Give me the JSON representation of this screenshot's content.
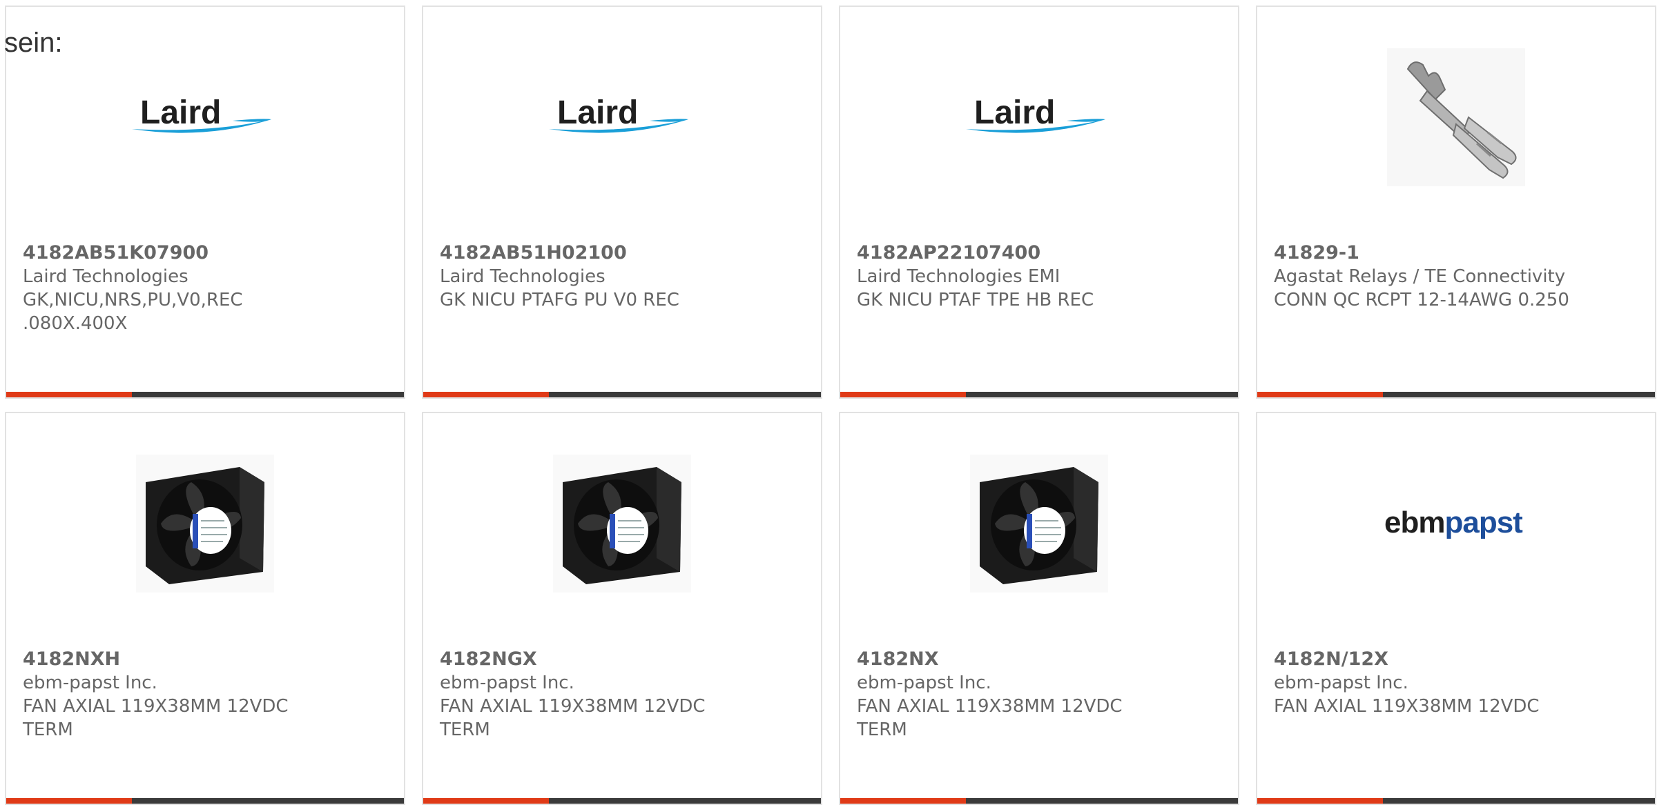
{
  "intro_text": "sein:",
  "colors": {
    "accent_bar": "#e03a17",
    "bar_dark": "#3a3a3a",
    "card_text": "#666666",
    "laird_blue": "#1a9fd8",
    "ebmpapst_blue": "#1d4e9b"
  },
  "products": [
    {
      "part_number": "4182AB51K07900",
      "manufacturer": "Laird Technologies",
      "desc_line1": "GK,NICU,NRS,PU,V0,REC",
      "desc_line2": ".080X.400X",
      "image": "laird-logo",
      "logo_text": "Laird"
    },
    {
      "part_number": "4182AB51H02100",
      "manufacturer": "Laird Technologies",
      "desc_line1": "GK NICU PTAFG PU V0 REC",
      "desc_line2": "",
      "image": "laird-logo",
      "logo_text": "Laird"
    },
    {
      "part_number": "4182AP22107400",
      "manufacturer": "Laird Technologies EMI",
      "desc_line1": "GK NICU PTAF TPE HB REC",
      "desc_line2": "",
      "image": "laird-logo",
      "logo_text": "Laird"
    },
    {
      "part_number": "41829-1",
      "manufacturer": "Agastat Relays / TE Connectivity",
      "desc_line1": "CONN QC RCPT 12-14AWG 0.250",
      "desc_line2": "",
      "image": "connector-image"
    },
    {
      "part_number": "4182NXH",
      "manufacturer": "ebm-papst Inc.",
      "desc_line1": "FAN AXIAL 119X38MM 12VDC",
      "desc_line2": "TERM",
      "image": "fan-image"
    },
    {
      "part_number": "4182NGX",
      "manufacturer": "ebm-papst Inc.",
      "desc_line1": "FAN AXIAL 119X38MM 12VDC",
      "desc_line2": "TERM",
      "image": "fan-image"
    },
    {
      "part_number": "4182NX",
      "manufacturer": "ebm-papst Inc.",
      "desc_line1": "FAN AXIAL 119X38MM 12VDC",
      "desc_line2": "TERM",
      "image": "fan-image"
    },
    {
      "part_number": "4182N/12X",
      "manufacturer": "ebm-papst Inc.",
      "desc_line1": "FAN AXIAL 119X38MM 12VDC",
      "desc_line2": "",
      "image": "ebmpapst-logo",
      "logo_text_1": "ebm",
      "logo_text_2": "papst"
    }
  ]
}
